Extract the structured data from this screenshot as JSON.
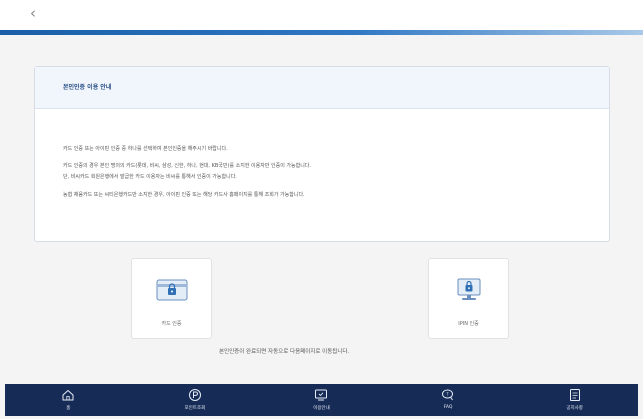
{
  "header": {
    "back_icon": "chevron-left-icon",
    "back_glyph": "‹"
  },
  "notice": {
    "title": "본인인증 이용 안내",
    "lines": [
      "카드 인증 또는 아이핀 인증 중 하나를 선택하여 본인인증을 해주시기 바랍니다.",
      "카드 인증의 경우 본인 명의의 카드(롯데, 비씨, 삼성, 신한, 하나, 현대, KB국민)를 소지한 이용자만 인증이 가능합니다.",
      "단, 비씨카드 회원은행에서 발급한 카드 이용자는 비씨를 통해서 인증이 가능합니다.",
      "농협 채움카드 또는 씨티은행카드만 소지한 경우, 아이핀 인증 또는 해당 카드사 홈페이지를 통해 조회가 가능합니다."
    ]
  },
  "auth_options": [
    {
      "label": "카드 인증",
      "icon": "card-lock-icon"
    },
    {
      "label": "IPIN 인증",
      "icon": "monitor-lock-icon"
    }
  ],
  "redirect_note": "본인인증이 완료되면 자동으로 다음페이지로 이동됩니다.",
  "bottom_nav": [
    {
      "label": "홈",
      "icon": "home-icon"
    },
    {
      "label": "포인트조회",
      "icon": "point-icon"
    },
    {
      "label": "이용안내",
      "icon": "guide-monitor-icon"
    },
    {
      "label": "FAQ",
      "icon": "faq-chat-icon"
    },
    {
      "label": "공지사항",
      "icon": "notice-list-icon"
    }
  ],
  "colors": {
    "accent": "#2f77c4",
    "nav_bg": "#162c57",
    "lock_fill": "#2f6fb6",
    "card_bg": "#e3edf8"
  }
}
